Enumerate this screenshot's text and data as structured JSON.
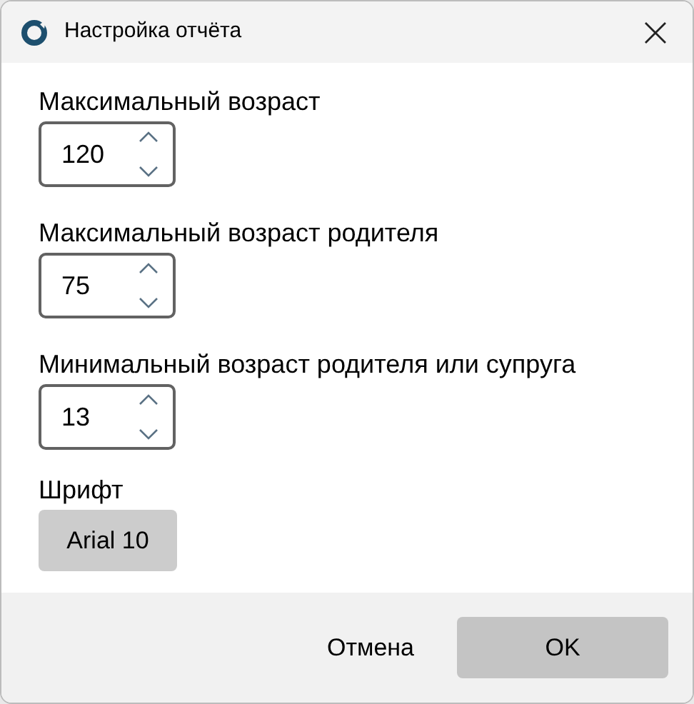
{
  "window": {
    "title": "Настройка отчёта"
  },
  "fields": [
    {
      "label": "Максимальный возраст",
      "value": "120"
    },
    {
      "label": "Максимальный возраст родителя",
      "value": "75"
    },
    {
      "label": "Минимальный возраст родителя или супруга",
      "value": "13"
    }
  ],
  "font": {
    "label": "Шрифт",
    "button": "Arial 10"
  },
  "buttons": {
    "cancel": "Отмена",
    "ok": "OK"
  }
}
